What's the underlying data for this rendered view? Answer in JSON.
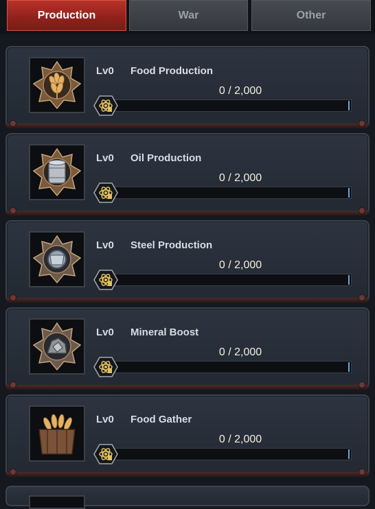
{
  "tabs": [
    {
      "label": "Production",
      "active": true
    },
    {
      "label": "War",
      "active": false
    },
    {
      "label": "Other",
      "active": false
    }
  ],
  "colors": {
    "accent": "#b9322a",
    "card_bg": "#2d3440",
    "progress_text": "#f3efe0"
  },
  "cards": [
    {
      "level": "Lv0",
      "name": "Food Production",
      "progress": "0 / 2,000",
      "fraction": 0,
      "icon": "wheat-medal-icon"
    },
    {
      "level": "Lv0",
      "name": "Oil Production",
      "progress": "0 / 2,000",
      "fraction": 0,
      "icon": "oil-barrel-medal-icon"
    },
    {
      "level": "Lv0",
      "name": "Steel Production",
      "progress": "0 / 2,000",
      "fraction": 0,
      "icon": "steel-medal-icon"
    },
    {
      "level": "Lv0",
      "name": "Mineral Boost",
      "progress": "0 / 2,000",
      "fraction": 0,
      "icon": "mineral-medal-icon"
    },
    {
      "level": "Lv0",
      "name": "Food Gather",
      "progress": "0 / 2,000",
      "fraction": 0,
      "icon": "food-crate-icon"
    }
  ]
}
